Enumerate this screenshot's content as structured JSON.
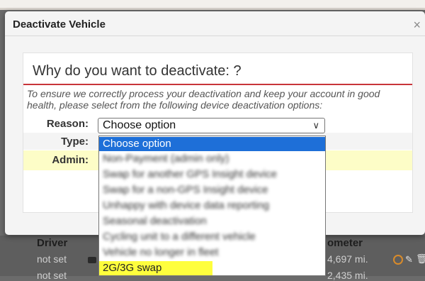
{
  "background": {
    "table_headers": [
      "Driver",
      "ometer"
    ],
    "rows": [
      {
        "driver": "not set",
        "odometer": "4,697 mi."
      },
      {
        "driver": "not set",
        "odometer": "2,435 mi."
      }
    ]
  },
  "modal": {
    "title": "Deactivate Vehicle",
    "close_icon": "×",
    "question": "Why do you want to deactivate: ?",
    "intro": "To ensure we correctly process your deactivation and keep your account in good health, please select from the following device deactivation options:",
    "fields": {
      "reason_label": "Reason:",
      "type_label": "Type:",
      "admin_label": "Admin:"
    },
    "select": {
      "value": "Choose option",
      "chevron": "∨"
    },
    "options": [
      "Choose option",
      "Non-Payment (admin only)",
      "Swap for another GPS Insight device",
      "Swap for a non-GPS Insight device",
      "Unhappy with device data reporting",
      "Seasonal deactivation",
      "Cycling unit to a different vehicle",
      "Vehicle no longer in fleet",
      "2G/3G swap"
    ]
  },
  "colors": {
    "accent_rule": "#c8353a",
    "selected_option": "#1e6fd8",
    "highlight_option": "#fefe3d",
    "admin_row": "#fdfdc7"
  }
}
